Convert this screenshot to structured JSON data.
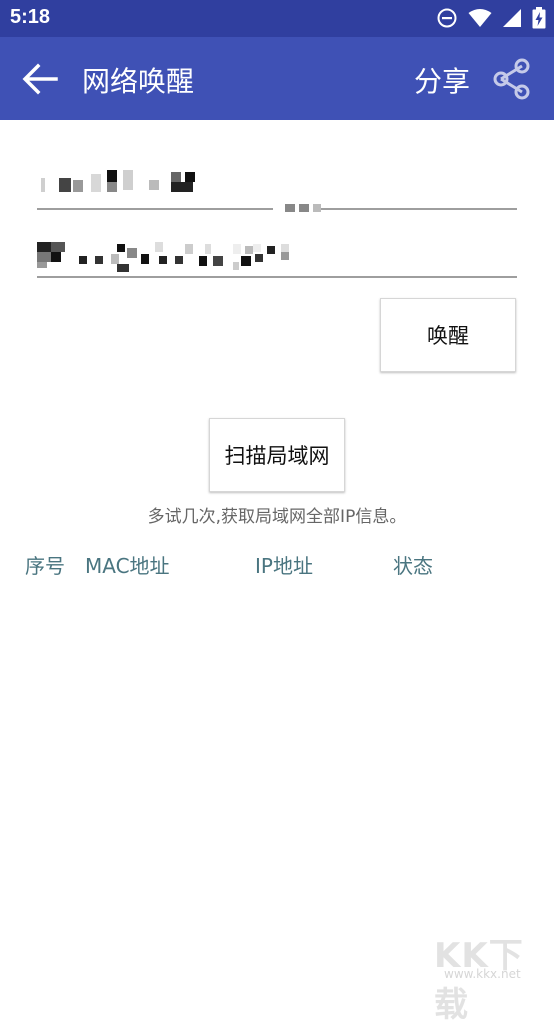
{
  "status_bar": {
    "time": "5:18",
    "icons": [
      "do-not-disturb-icon",
      "wifi-icon",
      "signal-icon",
      "battery-charging-icon"
    ]
  },
  "app_bar": {
    "title": "网络唤醒",
    "share_label": "分享",
    "color": "#3f51b5",
    "status_color": "#303f9f"
  },
  "form": {
    "ip_field_value": "",
    "mac_field_value": "",
    "wake_button": "唤醒"
  },
  "scan": {
    "scan_button": "扫描局域网",
    "hint": "多试几次,获取局域网全部IP信息。"
  },
  "table": {
    "columns": [
      "序号",
      "MAC地址",
      "IP地址",
      "状态"
    ],
    "header_color": "#4a7580"
  },
  "watermark": {
    "text": "KK下载",
    "url": "www.kkx.net"
  }
}
